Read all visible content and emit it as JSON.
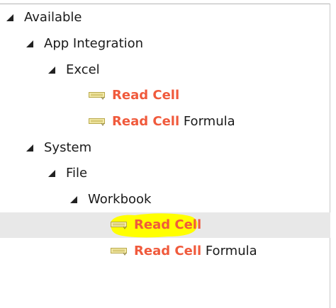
{
  "tree": {
    "root": {
      "label": "Available"
    },
    "app_integration": {
      "label": "App Integration"
    },
    "excel": {
      "label": "Excel",
      "items": [
        {
          "highlight": "Read Cell",
          "rest": ""
        },
        {
          "highlight": "Read Cell",
          "rest": " Formula"
        }
      ]
    },
    "system": {
      "label": "System"
    },
    "file": {
      "label": "File"
    },
    "workbook": {
      "label": "Workbook",
      "items": [
        {
          "highlight": "Read Cell",
          "rest": ""
        },
        {
          "highlight": "Read Cell",
          "rest": " Formula"
        }
      ]
    }
  },
  "colors": {
    "highlight_text": "#f05a3c",
    "selection_background": "#e8e8e8",
    "marker": "#ffff00"
  },
  "icons": {
    "expander": "expanded-triangle-icon",
    "activity": "activity-tag-icon"
  }
}
